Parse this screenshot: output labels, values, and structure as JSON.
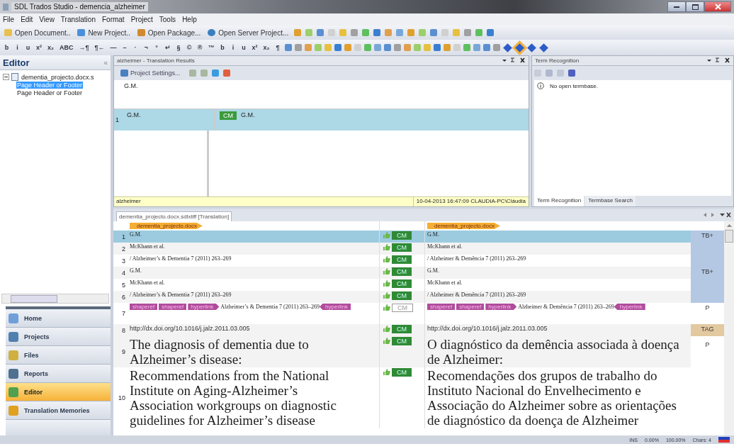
{
  "window": {
    "title": "SDL Trados Studio - demencia_alzheimer"
  },
  "menu": [
    "File",
    "Edit",
    "View",
    "Translation",
    "Format",
    "Project",
    "Tools",
    "Help"
  ],
  "toolbar": [
    {
      "label": "Open Document..",
      "kind": "folder"
    },
    {
      "label": "New Project..",
      "kind": "box"
    },
    {
      "label": "Open Package...",
      "kind": "package"
    },
    {
      "label": "Open Server Project...",
      "kind": "globe"
    }
  ],
  "format_toolbar": [
    "b",
    "i",
    "u",
    "x²",
    "x₂",
    "ABC",
    "→¶",
    "¶←",
    "—",
    "–",
    "·",
    "¬",
    "°",
    "↵",
    "§",
    "©",
    "®",
    "™",
    "b",
    "i",
    "u",
    "x²",
    "x₂",
    "¶"
  ],
  "sidebar": {
    "title": "Editor",
    "collapse": "«",
    "tree": [
      {
        "label": "dementia_projecto.docx.s",
        "expanded": true,
        "selected": false,
        "children": [
          {
            "label": "Page Header or Footer",
            "selected": true
          },
          {
            "label": "Page Header or Footer",
            "selected": false
          }
        ]
      }
    ],
    "nav": [
      {
        "label": "Home",
        "kind": "home",
        "selected": false
      },
      {
        "label": "Projects",
        "kind": "projects",
        "selected": false
      },
      {
        "label": "Files",
        "kind": "files",
        "selected": false
      },
      {
        "label": "Reports",
        "kind": "reports",
        "selected": false
      },
      {
        "label": "Editor",
        "kind": "editor",
        "selected": true
      },
      {
        "label": "Translation Memories",
        "kind": "tm",
        "selected": false
      }
    ]
  },
  "translation_results": {
    "title": "alzheimer - Translation Results",
    "settings": "Project Settings...",
    "query": "G.M.",
    "results": [
      {
        "number": "1",
        "source": "G.M.",
        "badge": "CM",
        "target": "G.M."
      }
    ],
    "footer_name": "alzheimer",
    "footer_info": "10-04-2013 16:47:09  CLAUDIA-PC\\Cláudia"
  },
  "term_recognition": {
    "title": "Term Recognition",
    "message": "No open termbase.",
    "tabs": [
      {
        "label": "Term Recognition",
        "selected": true
      },
      {
        "label": "Termbase Search",
        "selected": false
      }
    ]
  },
  "editor": {
    "document_tab": "dementia_projecto.docx.sdlxliff [Translation]",
    "source_file": "dementia_projecto.docx",
    "target_file": "dementia_projecto.docx",
    "rows": [
      {
        "number": "1",
        "kind": "small",
        "selected": true,
        "status": "CM",
        "confirmed": true,
        "source": [
          {
            "kind": "text",
            "text": "G.M."
          }
        ],
        "target": [
          {
            "kind": "text",
            "text": "G.M."
          }
        ],
        "note": {
          "text": "TB+",
          "color": "#b4c8e4"
        }
      },
      {
        "number": "2",
        "kind": "small",
        "selected": false,
        "status": "CM",
        "confirmed": true,
        "source": [
          {
            "kind": "text",
            "text": "McKhann et al."
          }
        ],
        "target": [
          {
            "kind": "text",
            "text": "McKhann et al."
          }
        ],
        "note": {
          "color": "#b4c8e4"
        }
      },
      {
        "number": "3",
        "kind": "small",
        "selected": false,
        "status": "CM",
        "confirmed": true,
        "source": [
          {
            "kind": "text",
            "text": "/ Alzheimer’s & Dementia 7 (2011) 263–269"
          }
        ],
        "target": [
          {
            "kind": "text",
            "text": "/ Alzheimer & Demência 7 (2011) 263–269"
          }
        ],
        "note": {
          "color": "#b4c8e4"
        }
      },
      {
        "number": "4",
        "kind": "small",
        "selected": false,
        "status": "CM",
        "confirmed": true,
        "source": [
          {
            "kind": "text",
            "text": "G.M."
          }
        ],
        "target": [
          {
            "kind": "text",
            "text": "G.M."
          }
        ],
        "note": {
          "text": "TB+",
          "color": "#b4c8e4"
        }
      },
      {
        "number": "5",
        "kind": "small",
        "selected": false,
        "status": "CM",
        "confirmed": true,
        "source": [
          {
            "kind": "text",
            "text": "McKhann et al."
          }
        ],
        "target": [
          {
            "kind": "text",
            "text": "McKhann et al."
          }
        ],
        "note": {
          "color": "#b4c8e4"
        }
      },
      {
        "number": "6",
        "kind": "small",
        "selected": false,
        "status": "CM",
        "confirmed": true,
        "source": [
          {
            "kind": "text",
            "text": "/ Alzheimer’s & Dementia 7 (2011) 263–269"
          }
        ],
        "target": [
          {
            "kind": "text",
            "text": "/ Alzheimer & Demência 7 (2011) 263–269"
          }
        ],
        "note": {
          "color": "#b4c8e4"
        }
      },
      {
        "number": "7",
        "kind": "small",
        "selected": false,
        "status": "CM",
        "confirmed": false,
        "source": [
          {
            "kind": "tag",
            "text": "shaperef"
          },
          {
            "kind": "tag",
            "text": "shaperef"
          },
          {
            "kind": "open",
            "text": "hyperlink"
          },
          {
            "kind": "text",
            "text": "Alzheimer’s & Dementia 7 (2011) 263–269"
          },
          {
            "kind": "close",
            "text": "hyperlink"
          }
        ],
        "target": [
          {
            "kind": "tag",
            "text": "shaperef"
          },
          {
            "kind": "tag",
            "text": "shaperef"
          },
          {
            "kind": "open",
            "text": "hyperlink"
          },
          {
            "kind": "text",
            "text": "Alzheimer & Demência 7 (2011) 263–269"
          },
          {
            "kind": "close",
            "text": "hyperlink"
          }
        ],
        "note": {
          "text": "P",
          "color": "#ffffff"
        }
      },
      {
        "number": "8",
        "kind": "small",
        "selected": false,
        "status": "CM",
        "confirmed": true,
        "source": [
          {
            "kind": "url",
            "text": "http://dx.doi.org/10.1016/j.jalz.2011.03.005"
          }
        ],
        "target": [
          {
            "kind": "url",
            "text": "http://dx.doi.org/10.1016/j.jalz.2011.03.005"
          }
        ],
        "note": {
          "text": "TAG",
          "color": "#e3c9a0"
        }
      },
      {
        "number": "9",
        "kind": "large",
        "selected": false,
        "status": "CM",
        "confirmed": true,
        "source": [
          {
            "kind": "text",
            "text": "The diagnosis of dementia due to Alzheimer’s disease:"
          }
        ],
        "target": [
          {
            "kind": "text",
            "text": "O diagnóstico da demência associada à doença de Alzheimer:"
          }
        ],
        "note": {
          "text": "P",
          "color": "#ffffff"
        }
      },
      {
        "number": "10",
        "kind": "large",
        "selected": false,
        "status": "CM",
        "confirmed": true,
        "source": [
          {
            "kind": "text",
            "text": "Recommendations from the National Institute on Aging-Alzheimer’s Association workgroups on diagnostic guidelines for Alzheimer’s disease"
          }
        ],
        "target": [
          {
            "kind": "text",
            "text": "Recomendações dos grupos de trabalho do Instituto Nacional do Envelhecimento e Associação do Alzheimer sobre as orientações de diagnóstico da doença de Alzheimer"
          }
        ]
      }
    ]
  },
  "status_bar": {
    "mode": "INS",
    "items": [
      "0.00%",
      "100.00%",
      "Chars: 4"
    ]
  }
}
